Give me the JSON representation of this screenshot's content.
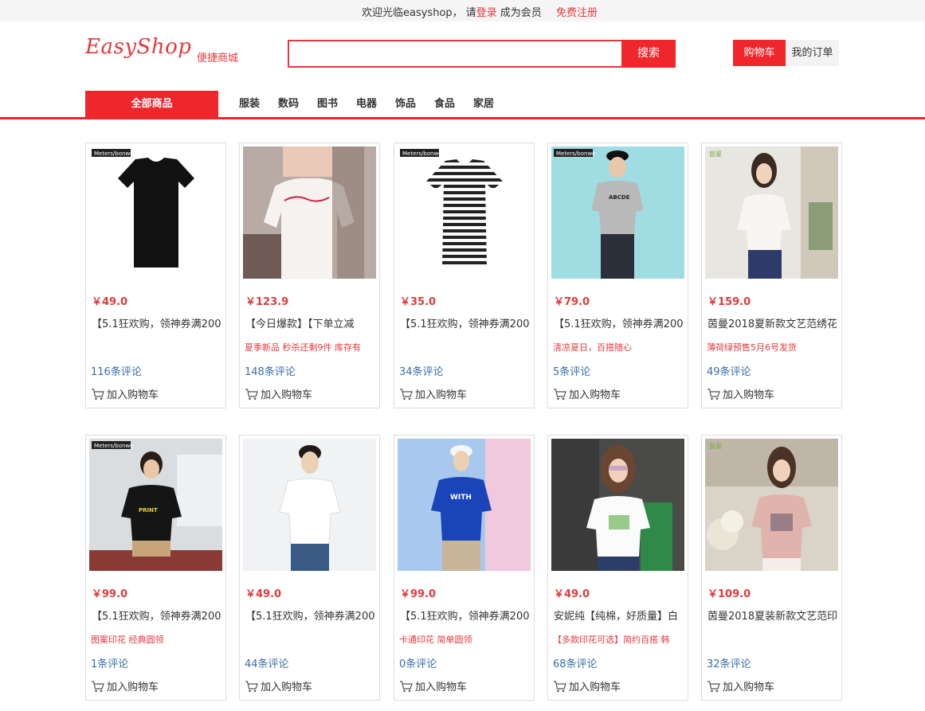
{
  "topbar": {
    "welcome": "欢迎光临easyshop，",
    "please": "请",
    "login": "登录",
    "become_member": "成为会员",
    "register": "免费注册"
  },
  "header": {
    "logo": "EasyShop",
    "logo_sub": "便捷商城",
    "search_placeholder": "",
    "search_button": "搜索",
    "cart_button": "购物车",
    "orders_button": "我的订单"
  },
  "nav": {
    "all": "全部商品",
    "items": [
      "服装",
      "数码",
      "图书",
      "电器",
      "饰品",
      "食品",
      "家居"
    ]
  },
  "add_to_cart_label": "加入购物车",
  "products": [
    {
      "price": "￥49.0",
      "title": "【5.1狂欢购，领神券满200",
      "promo": "",
      "reviews": "116条评论",
      "image": "black-tshirt-brand-tag"
    },
    {
      "price": "￥123.9",
      "title": "【今日爆款】【下单立减",
      "promo": "夏季新品 秒杀还剩9件 库存有",
      "reviews": "148条评论",
      "image": "woman-white-tshirt-selfie"
    },
    {
      "price": "￥35.0",
      "title": "【5.1狂欢购，领神券满200",
      "promo": "",
      "reviews": "34条评论",
      "image": "striped-tshirt-brand-tag"
    },
    {
      "price": "￥79.0",
      "title": "【5.1狂欢购，领神券满200",
      "promo": "清凉夏日，百搭随心",
      "reviews": "5条评论",
      "image": "man-grey-tshirt-cap"
    },
    {
      "price": "￥159.0",
      "title": "茵曼2018夏新款文艺范绣花",
      "promo": "薄荷绿预售5月6号发货",
      "reviews": "49条评论",
      "image": "woman-white-blouse"
    },
    {
      "price": "￥99.0",
      "title": "【5.1狂欢购，领神券满200",
      "promo": "图案印花 经典圆领",
      "reviews": "1条评论",
      "image": "man-black-print-tshirt"
    },
    {
      "price": "￥49.0",
      "title": "【5.1狂欢购，领神券满200",
      "promo": "",
      "reviews": "44条评论",
      "image": "man-white-tshirt"
    },
    {
      "price": "￥99.0",
      "title": "【5.1狂欢购，领神券满200",
      "promo": "卡通印花 简单圆领",
      "reviews": "0条评论",
      "image": "man-blue-tshirt-cap"
    },
    {
      "price": "￥49.0",
      "title": "安妮纯【纯棉，好质量】白",
      "promo": "【多款印花可选】简约百搭 韩",
      "reviews": "68条评论",
      "image": "woman-sunglasses-white-tshirt"
    },
    {
      "price": "￥109.0",
      "title": "茵曼2018夏装新款文艺范印",
      "promo": "",
      "reviews": "32条评论",
      "image": "woman-pink-print-tshirt"
    }
  ],
  "brand_tags": [
    "Meters/bonwe",
    "茵曼"
  ],
  "colors": {
    "accent": "#f0262d",
    "price": "#e4393c",
    "review": "#3a6ea8"
  }
}
